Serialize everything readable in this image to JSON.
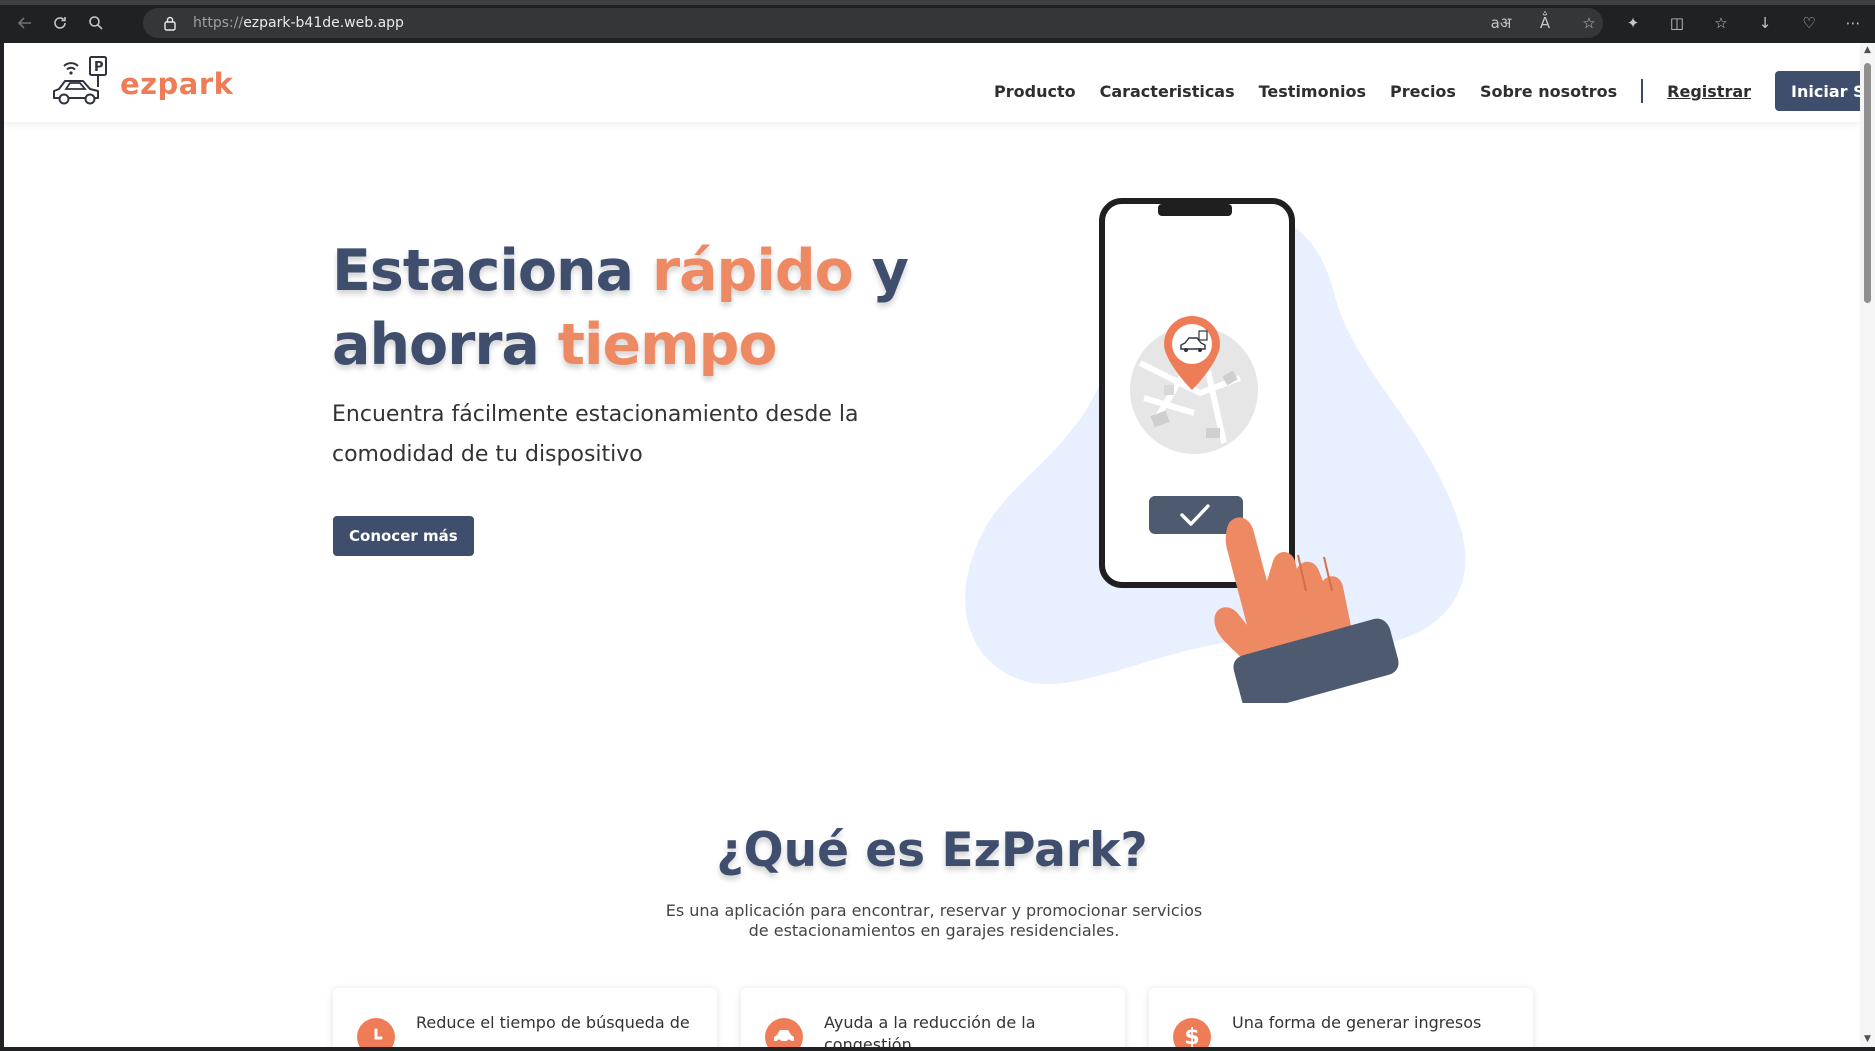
{
  "browser": {
    "url_scheme": "https://",
    "url_host": "ezpark-b41de.web.app",
    "icons": [
      "back-icon",
      "reload-icon",
      "search-icon",
      "lock-icon",
      "translate-icon",
      "read-aloud-icon",
      "favorite-star-icon",
      "extensions-icon",
      "split-screen-icon",
      "favorites-icon",
      "downloads-icon",
      "browser-essentials-icon",
      "more-menu-icon"
    ]
  },
  "header": {
    "logo_text": "ezpark",
    "nav": [
      "Producto",
      "Caracteristicas",
      "Testimonios",
      "Precios",
      "Sobre nosotros"
    ],
    "register_label": "Registrar",
    "login_label": "Iniciar Sesión"
  },
  "hero": {
    "title_part1": "Estaciona ",
    "title_accent1": "rápido",
    "title_part2": " y ahorra ",
    "title_accent2": "tiempo",
    "subtitle": "Encuentra fácilmente estacionamiento desde la comodidad de tu dispositivo",
    "cta_label": "Conocer más"
  },
  "about": {
    "title": "¿Qué es EzPark?",
    "description": "Es una aplicación para encontrar, reservar y promocionar servicios de estacionamientos en garajes residenciales.",
    "cards": [
      {
        "icon": "clock-icon",
        "text": "Reduce el tiempo de búsqueda de"
      },
      {
        "icon": "car-icon",
        "text": "Ayuda a la reducción de la congestión"
      },
      {
        "icon": "dollar-icon",
        "text": "Una forma de generar ingresos"
      }
    ]
  },
  "colors": {
    "brand_orange": "#ee7d57",
    "brand_navy": "#3e4e6c",
    "blob_blue": "#e8efff"
  }
}
